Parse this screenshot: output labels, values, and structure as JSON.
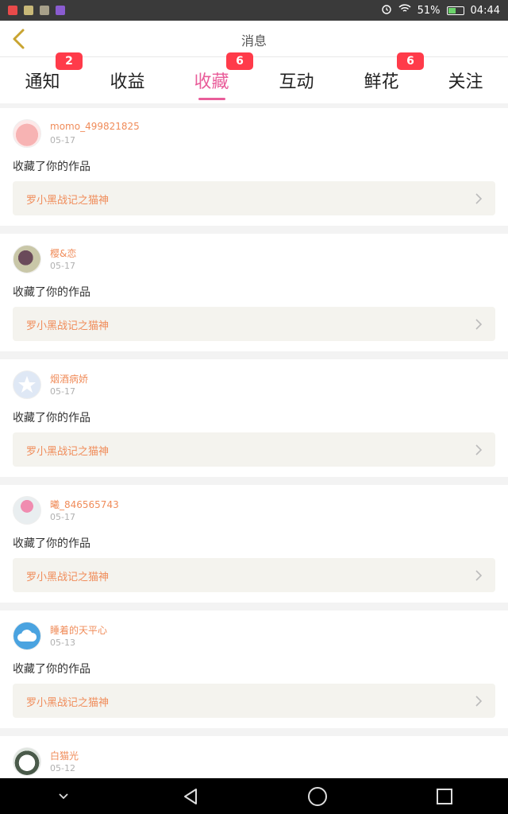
{
  "status_bar": {
    "signal_text": "51%",
    "time": "04:44",
    "battery_level": 0.51
  },
  "header": {
    "title": "消息"
  },
  "tabs": [
    {
      "label": "通知",
      "badge": "2"
    },
    {
      "label": "收益",
      "badge": ""
    },
    {
      "label": "收藏",
      "badge": "6",
      "active": true
    },
    {
      "label": "互动",
      "badge": ""
    },
    {
      "label": "鲜花",
      "badge": "6"
    },
    {
      "label": "关注",
      "badge": ""
    }
  ],
  "items": [
    {
      "user": "momo_499821825",
      "time": "05-17",
      "action": "收藏了你的作品",
      "work": "罗小黑战记之猫神"
    },
    {
      "user": "樱&恋",
      "time": "05-17",
      "action": "收藏了你的作品",
      "work": "罗小黑战记之猫神"
    },
    {
      "user": "烟酒病娇",
      "time": "05-17",
      "action": "收藏了你的作品",
      "work": "罗小黑战记之猫神"
    },
    {
      "user": "曦_846565743",
      "time": "05-17",
      "action": "收藏了你的作品",
      "work": "罗小黑战记之猫神"
    },
    {
      "user": "睡着的天平心",
      "time": "05-13",
      "action": "收藏了你的作品",
      "work": "罗小黑战记之猫神"
    },
    {
      "user": "白猫光",
      "time": "05-12",
      "action": "",
      "work": ""
    }
  ],
  "colors": {
    "accent": "#e95d9a",
    "badge": "#ff3b4a",
    "username": "#f08c5a",
    "back_arrow": "#c9a431"
  }
}
